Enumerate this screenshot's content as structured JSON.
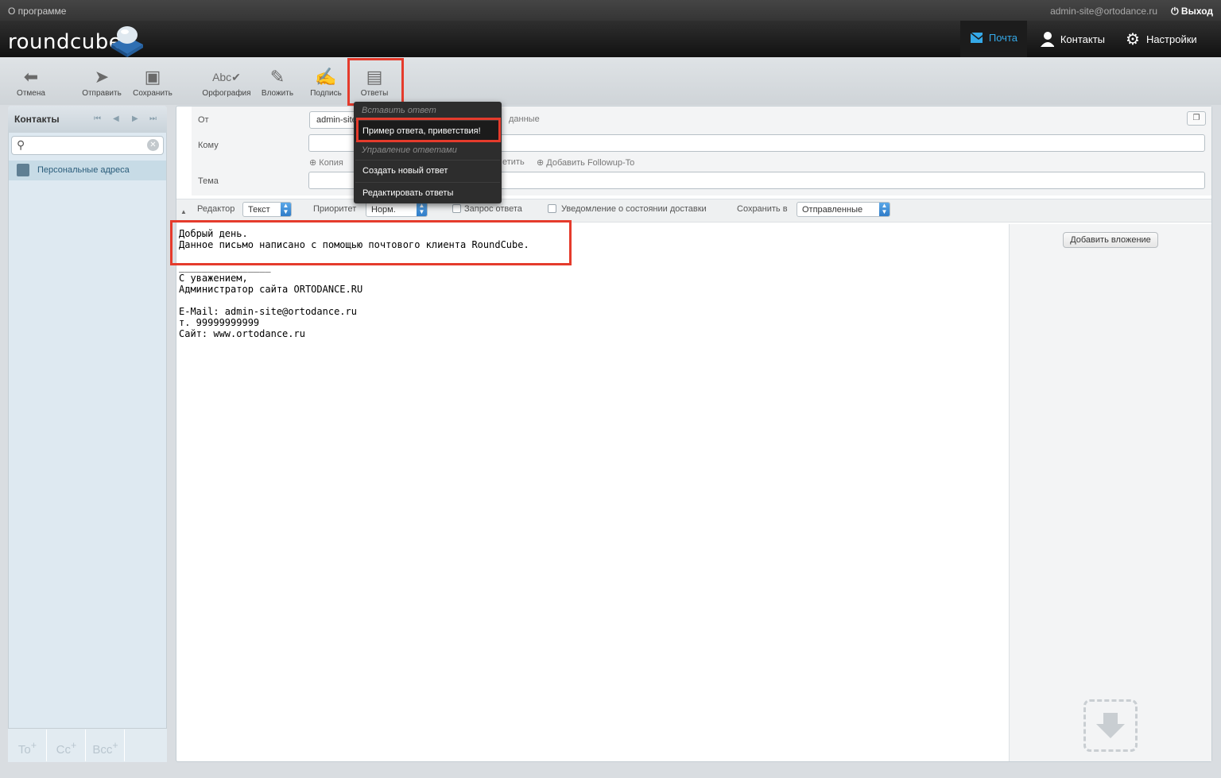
{
  "topbar": {
    "about": "О программе",
    "user_email": "admin-site@ortodance.ru",
    "logout": "Выход"
  },
  "header": {
    "logo": "roundcube",
    "tabs": [
      {
        "label": "Почта",
        "icon": "envelope-icon",
        "active": true
      },
      {
        "label": "Контакты",
        "icon": "person-icon",
        "active": false
      },
      {
        "label": "Настройки",
        "icon": "gear-icon",
        "active": false
      }
    ]
  },
  "toolbar": {
    "cancel": "Отмена",
    "send": "Отправить",
    "save": "Сохранить",
    "spell": "Орфография",
    "attach": "Вложить",
    "signature": "Подпись",
    "responses": "Ответы"
  },
  "sidebar": {
    "title": "Контакты",
    "search_placeholder": "",
    "items": [
      {
        "label": "Персональные адреса"
      }
    ],
    "footer": {
      "to": "To",
      "cc": "Cc",
      "bcc": "Bcc"
    }
  },
  "compose": {
    "from_label": "От",
    "from_value": "admin-site@ortodance.ru",
    "edit_identity": "данные",
    "to_label": "Кому",
    "add_cc": "Копия",
    "add_reply": "етить",
    "add_followup": "Добавить Followup-To",
    "subject_label": "Тема",
    "editor_label": "Редактор",
    "editor_value": "Текст",
    "priority_label": "Приоритет",
    "priority_value": "Норм.",
    "receipt_label": "Запрос ответа",
    "dsn_label": "Уведомление о состоянии доставки",
    "saveto_label": "Сохранить в",
    "saveto_value": "Отправленные",
    "body": "Добрый день.\nДанное письмо написано с помощью почтового клиента RoundCube.\n\n________________\nС уважением,\nАдминистратор сайта ORTODANCE.RU\n\nE-Mail: admin-site@ortodance.ru\nт. 99999999999\nСайт: www.ortodance.ru",
    "add_attachment": "Добавить вложение"
  },
  "responses_menu": {
    "insert_header": "Вставить ответ",
    "responses": [
      "Пример ответа, приветствия!"
    ],
    "manage_header": "Управление ответами",
    "create": "Создать новый ответ",
    "edit": "Редактировать ответы"
  },
  "colors": {
    "accent": "#35a9e8",
    "highlight": "#e53b2c"
  }
}
